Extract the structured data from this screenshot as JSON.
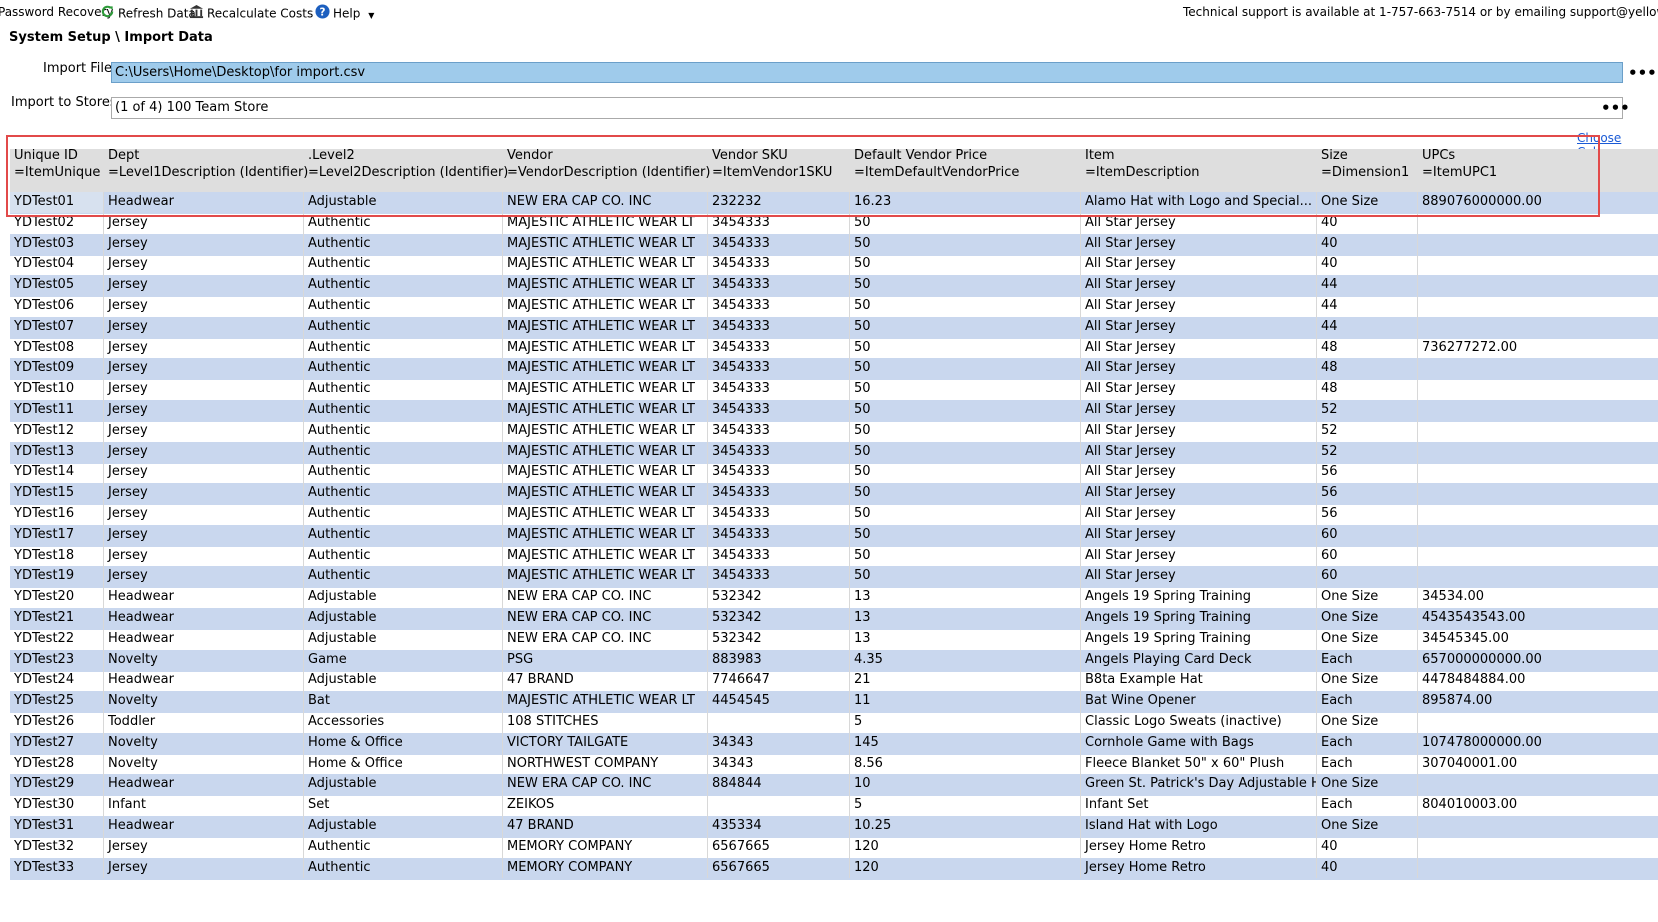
{
  "toolbar": {
    "password_recovery": "Password Recovery",
    "refresh_data": "Refresh Data",
    "recalculate_costs": "Recalculate Costs",
    "help": "Help",
    "support_text": "Technical support is available at 1-757-663-7514 or by emailing support@yellowdogsoftwa"
  },
  "page": {
    "breadcrumb": "System Setup \\ Import Data"
  },
  "import_file": {
    "label": "Import File",
    "value": "C:\\Users\\Home\\Desktop\\for import.csv",
    "browse": "•••"
  },
  "import_stores": {
    "label": "Import to Stores",
    "value": "(1 of 4) 100 Team Store",
    "browse": "•••"
  },
  "choose_columns": "Choose Colum",
  "grid": {
    "columns": [
      {
        "title": "Unique ID",
        "mapping": "=ItemUnique"
      },
      {
        "title": "Dept",
        "mapping": "=Level1Description (Identifier)"
      },
      {
        "title": ".Level2",
        "mapping": "=Level2Description (Identifier)"
      },
      {
        "title": "Vendor",
        "mapping": "=VendorDescription (Identifier)"
      },
      {
        "title": "Vendor SKU",
        "mapping": "=ItemVendor1SKU"
      },
      {
        "title": "Default Vendor Price",
        "mapping": "=ItemDefaultVendorPrice"
      },
      {
        "title": "Item",
        "mapping": "=ItemDescription"
      },
      {
        "title": "Size",
        "mapping": "=Dimension1"
      },
      {
        "title": "UPCs",
        "mapping": "=ItemUPC1"
      }
    ],
    "rows": [
      [
        "YDTest01",
        "Headwear",
        "Adjustable",
        "NEW ERA CAP CO. INC",
        "232232",
        "16.23",
        "Alamo Hat with Logo and Special...",
        "One Size",
        "889076000000.00"
      ],
      [
        "YDTest02",
        "Jersey",
        "Authentic",
        "MAJESTIC ATHLETIC WEAR LT",
        "3454333",
        "50",
        "All Star Jersey",
        "40",
        ""
      ],
      [
        "YDTest03",
        "Jersey",
        "Authentic",
        "MAJESTIC ATHLETIC WEAR LT",
        "3454333",
        "50",
        "All Star Jersey",
        "40",
        ""
      ],
      [
        "YDTest04",
        "Jersey",
        "Authentic",
        "MAJESTIC ATHLETIC WEAR LT",
        "3454333",
        "50",
        "All Star Jersey",
        "40",
        ""
      ],
      [
        "YDTest05",
        "Jersey",
        "Authentic",
        "MAJESTIC ATHLETIC WEAR LT",
        "3454333",
        "50",
        "All Star Jersey",
        "44",
        ""
      ],
      [
        "YDTest06",
        "Jersey",
        "Authentic",
        "MAJESTIC ATHLETIC WEAR LT",
        "3454333",
        "50",
        "All Star Jersey",
        "44",
        ""
      ],
      [
        "YDTest07",
        "Jersey",
        "Authentic",
        "MAJESTIC ATHLETIC WEAR LT",
        "3454333",
        "50",
        "All Star Jersey",
        "44",
        ""
      ],
      [
        "YDTest08",
        "Jersey",
        "Authentic",
        "MAJESTIC ATHLETIC WEAR LT",
        "3454333",
        "50",
        "All Star Jersey",
        "48",
        "736277272.00"
      ],
      [
        "YDTest09",
        "Jersey",
        "Authentic",
        "MAJESTIC ATHLETIC WEAR LT",
        "3454333",
        "50",
        "All Star Jersey",
        "48",
        ""
      ],
      [
        "YDTest10",
        "Jersey",
        "Authentic",
        "MAJESTIC ATHLETIC WEAR LT",
        "3454333",
        "50",
        "All Star Jersey",
        "48",
        ""
      ],
      [
        "YDTest11",
        "Jersey",
        "Authentic",
        "MAJESTIC ATHLETIC WEAR LT",
        "3454333",
        "50",
        "All Star Jersey",
        "52",
        ""
      ],
      [
        "YDTest12",
        "Jersey",
        "Authentic",
        "MAJESTIC ATHLETIC WEAR LT",
        "3454333",
        "50",
        "All Star Jersey",
        "52",
        ""
      ],
      [
        "YDTest13",
        "Jersey",
        "Authentic",
        "MAJESTIC ATHLETIC WEAR LT",
        "3454333",
        "50",
        "All Star Jersey",
        "52",
        ""
      ],
      [
        "YDTest14",
        "Jersey",
        "Authentic",
        "MAJESTIC ATHLETIC WEAR LT",
        "3454333",
        "50",
        "All Star Jersey",
        "56",
        ""
      ],
      [
        "YDTest15",
        "Jersey",
        "Authentic",
        "MAJESTIC ATHLETIC WEAR LT",
        "3454333",
        "50",
        "All Star Jersey",
        "56",
        ""
      ],
      [
        "YDTest16",
        "Jersey",
        "Authentic",
        "MAJESTIC ATHLETIC WEAR LT",
        "3454333",
        "50",
        "All Star Jersey",
        "56",
        ""
      ],
      [
        "YDTest17",
        "Jersey",
        "Authentic",
        "MAJESTIC ATHLETIC WEAR LT",
        "3454333",
        "50",
        "All Star Jersey",
        "60",
        ""
      ],
      [
        "YDTest18",
        "Jersey",
        "Authentic",
        "MAJESTIC ATHLETIC WEAR LT",
        "3454333",
        "50",
        "All Star Jersey",
        "60",
        ""
      ],
      [
        "YDTest19",
        "Jersey",
        "Authentic",
        "MAJESTIC ATHLETIC WEAR LT",
        "3454333",
        "50",
        "All Star Jersey",
        "60",
        ""
      ],
      [
        "YDTest20",
        "Headwear",
        "Adjustable",
        "NEW ERA CAP CO. INC",
        "532342",
        "13",
        "Angels 19 Spring Training",
        "One Size",
        "34534.00"
      ],
      [
        "YDTest21",
        "Headwear",
        "Adjustable",
        "NEW ERA CAP CO. INC",
        "532342",
        "13",
        "Angels 19 Spring Training",
        "One Size",
        "4543543543.00"
      ],
      [
        "YDTest22",
        "Headwear",
        "Adjustable",
        "NEW ERA CAP CO. INC",
        "532342",
        "13",
        "Angels 19 Spring Training",
        "One Size",
        "34545345.00"
      ],
      [
        "YDTest23",
        "Novelty",
        "Game",
        "PSG",
        "883983",
        "4.35",
        "Angels Playing Card Deck",
        "Each",
        "657000000000.00"
      ],
      [
        "YDTest24",
        "Headwear",
        "Adjustable",
        "47 BRAND",
        "7746647",
        "21",
        "B8ta Example Hat",
        "One Size",
        "4478484884.00"
      ],
      [
        "YDTest25",
        "Novelty",
        "Bat",
        "MAJESTIC ATHLETIC WEAR LT",
        "4454545",
        "11",
        "Bat Wine Opener",
        "Each",
        "895874.00"
      ],
      [
        "YDTest26",
        "Toddler",
        "Accessories",
        "108 STITCHES",
        "",
        "5",
        "Classic Logo Sweats (inactive)",
        "One Size",
        ""
      ],
      [
        "YDTest27",
        "Novelty",
        "Home & Office",
        "VICTORY TAILGATE",
        "34343",
        "145",
        "Cornhole Game with Bags",
        "Each",
        "107478000000.00"
      ],
      [
        "YDTest28",
        "Novelty",
        "Home & Office",
        "NORTHWEST COMPANY",
        "34343",
        "8.56",
        "Fleece Blanket 50\" x 60\" Plush",
        "Each",
        "307040001.00"
      ],
      [
        "YDTest29",
        "Headwear",
        "Adjustable",
        "NEW ERA CAP CO. INC",
        "884844",
        "10",
        "Green St. Patrick's Day Adjustable Hat",
        "One Size",
        ""
      ],
      [
        "YDTest30",
        "Infant",
        "Set",
        "ZEIKOS",
        "",
        "5",
        "Infant Set",
        "Each",
        "804010003.00"
      ],
      [
        "YDTest31",
        "Headwear",
        "Adjustable",
        "47 BRAND",
        "435334",
        "10.25",
        "Island Hat with Logo",
        "One Size",
        ""
      ],
      [
        "YDTest32",
        "Jersey",
        "Authentic",
        "MEMORY COMPANY",
        "6567665",
        "120",
        "Jersey Home Retro",
        "40",
        ""
      ],
      [
        "YDTest33",
        "Jersey",
        "Authentic",
        "MEMORY COMPANY",
        "6567665",
        "120",
        "Jersey Home Retro",
        "40",
        ""
      ]
    ]
  },
  "colors": {
    "row_alt": "#c9d7ee",
    "header_bg": "#dedede",
    "file_input_bg": "#9fcbeb",
    "highlight_border": "#e24a4a",
    "link": "#1a5ad6"
  }
}
